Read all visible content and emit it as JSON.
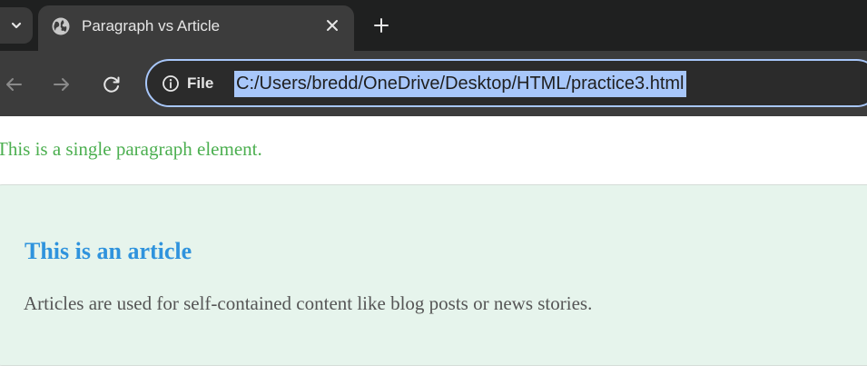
{
  "browser": {
    "tab": {
      "title": "Paragraph vs Article",
      "favicon_icon": "globe-icon",
      "close_icon": "close-icon"
    },
    "new_tab_icon": "plus-icon",
    "menu_icon": "chevron-down-icon",
    "nav": {
      "back_icon": "arrow-left-icon",
      "forward_icon": "arrow-right-icon",
      "reload_icon": "reload-icon"
    },
    "omnibox": {
      "site_info_icon": "info-icon",
      "site_info_label": "File",
      "url": "C:/Users/bredd/OneDrive/Desktop/HTML/practice3.html",
      "url_selected": true
    },
    "colors": {
      "tabstrip_bg": "#1f2020",
      "toolbar_bg": "#3c3c3c",
      "omnibox_focus": "#a8c7fa"
    }
  },
  "page": {
    "paragraph": "This is a single paragraph element.",
    "article": {
      "heading": "This is an article",
      "body": "Articles are used for self-contained content like blog posts or news stories."
    },
    "colors": {
      "paragraph_text": "#4caf50",
      "article_bg": "#e6f4ec",
      "article_heading": "#2f93dd",
      "article_body": "#555555"
    }
  }
}
